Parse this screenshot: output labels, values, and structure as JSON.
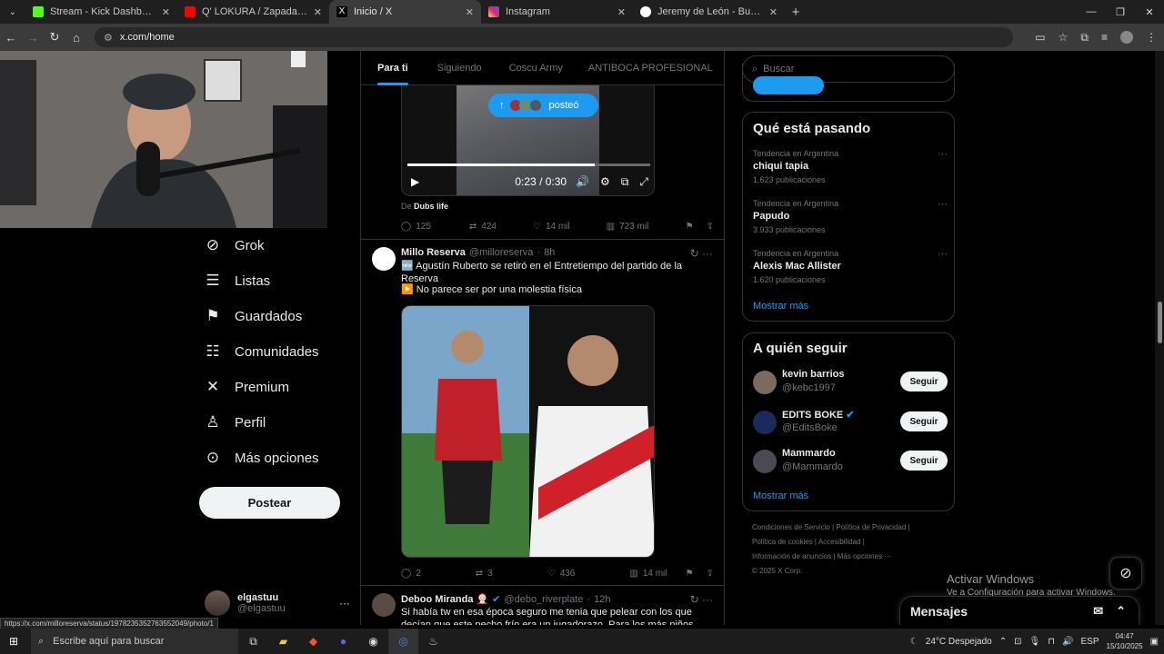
{
  "browser": {
    "tabs": [
      {
        "title": "Stream - Kick Dashboard",
        "icon": "kick-icon",
        "color": "#53fc18",
        "active": false
      },
      {
        "title": "Q' LOKURA / Zapada EN VIVO",
        "icon": "youtube-icon",
        "color": "#ff0000",
        "active": false
      },
      {
        "title": "Inicio / X",
        "icon": "x-icon",
        "color": "#ffffff",
        "active": true
      },
      {
        "title": "Instagram",
        "icon": "instagram-icon",
        "color": "#e1306c",
        "active": false
      },
      {
        "title": "Jeremy de León - Buscar con G",
        "icon": "google-icon",
        "color": "#4285f4",
        "active": false
      }
    ],
    "url": "x.com/home",
    "status_url": "https://x.com/milloreserva/status/1978235352763552049/photo/1"
  },
  "nav": {
    "items": [
      {
        "label": "Grok",
        "icon": "grok-icon",
        "glyph": "⊘"
      },
      {
        "label": "Listas",
        "icon": "list-icon",
        "glyph": "☰"
      },
      {
        "label": "Guardados",
        "icon": "bookmark-icon",
        "glyph": "⚑"
      },
      {
        "label": "Comunidades",
        "icon": "communities-icon",
        "glyph": "☷"
      },
      {
        "label": "Premium",
        "icon": "x-logo-icon",
        "glyph": "𝕏"
      },
      {
        "label": "Perfil",
        "icon": "profile-icon",
        "glyph": "♙"
      },
      {
        "label": "Más opciones",
        "icon": "more-options-icon",
        "glyph": "⊙"
      }
    ],
    "post_button": "Postear",
    "account": {
      "name": "elgastuu",
      "handle": "@elgastuu",
      "more": "···"
    }
  },
  "feed": {
    "tabs": [
      "Para ti",
      "Siguiendo",
      "Coscu Army",
      "ANTIBOCA PROFESIONAL"
    ],
    "posted_pill": "posteó",
    "video": {
      "time": "0:23 / 0:30",
      "progress": 0.77,
      "source_prefix": "De",
      "source": "Dubs life"
    },
    "video_actions": {
      "replies": "125",
      "reposts": "424",
      "likes": "14 mil",
      "views": "723 mil"
    },
    "tweet1": {
      "name": "Millo Reserva",
      "handle": "@milloreserva",
      "time": "8h",
      "line1": "🆕 Agustín Ruberto se retiró en el Entretiempo del partido de la Reserva",
      "line2": "▶️ No parece ser por una molestia física",
      "actions": {
        "replies": "2",
        "reposts": "3",
        "likes": "436",
        "views": "14 mil"
      }
    },
    "tweet2": {
      "name": "Deboo Miranda 🤶🏻",
      "handle": "@debo_riverplate",
      "time": "12h",
      "text": "Si había tw en esa época seguro me tenia que pelear con los que decían que este pecho frío era un jugadorazo. Para los más niños, digamos que es"
    }
  },
  "sidebar": {
    "search_placeholder": "Buscar",
    "trends_title": "Qué está pasando",
    "trends": [
      {
        "context": "Tendencia en Argentina",
        "name": "chiqui tapia",
        "posts": "1.623 publicaciones"
      },
      {
        "context": "Tendencia en Argentina",
        "name": "Papudo",
        "posts": "3.933 publicaciones"
      },
      {
        "context": "Tendencia en Argentina",
        "name": "Alexis Mac Allister",
        "posts": "1.620 publicaciones"
      }
    ],
    "show_more": "Mostrar más",
    "follow_title": "A quién seguir",
    "follow": [
      {
        "name": "kevin barrios",
        "handle": "@kebc1997",
        "button": "Seguir"
      },
      {
        "name": "EDITS BOKE",
        "handle": "@EditsBoke",
        "button": "Seguir"
      },
      {
        "name": "Mammardo",
        "handle": "@Mammardo",
        "button": "Seguir"
      }
    ],
    "footer": {
      "line1a": "Condiciones de Servicio",
      "line1b": "Política de Privacidad",
      "line2a": "Política de cookies",
      "line2b": "Accesibilidad",
      "line3a": "Información de anuncios",
      "line3b": "Más opciones ···",
      "copyright": "© 2025 X Corp."
    },
    "messages": "Mensajes"
  },
  "windows": {
    "activate_title": "Activar Windows",
    "activate_sub": "Ve a Configuración para activar Windows.",
    "search": "Escribe aquí para buscar",
    "weather": "24°C  Despejado",
    "lang": "ESP",
    "time": "04:47",
    "date": "15/10/2025"
  },
  "colors": {
    "accent": "#1d9bf0",
    "background": "#000000",
    "border": "#2f3336"
  }
}
